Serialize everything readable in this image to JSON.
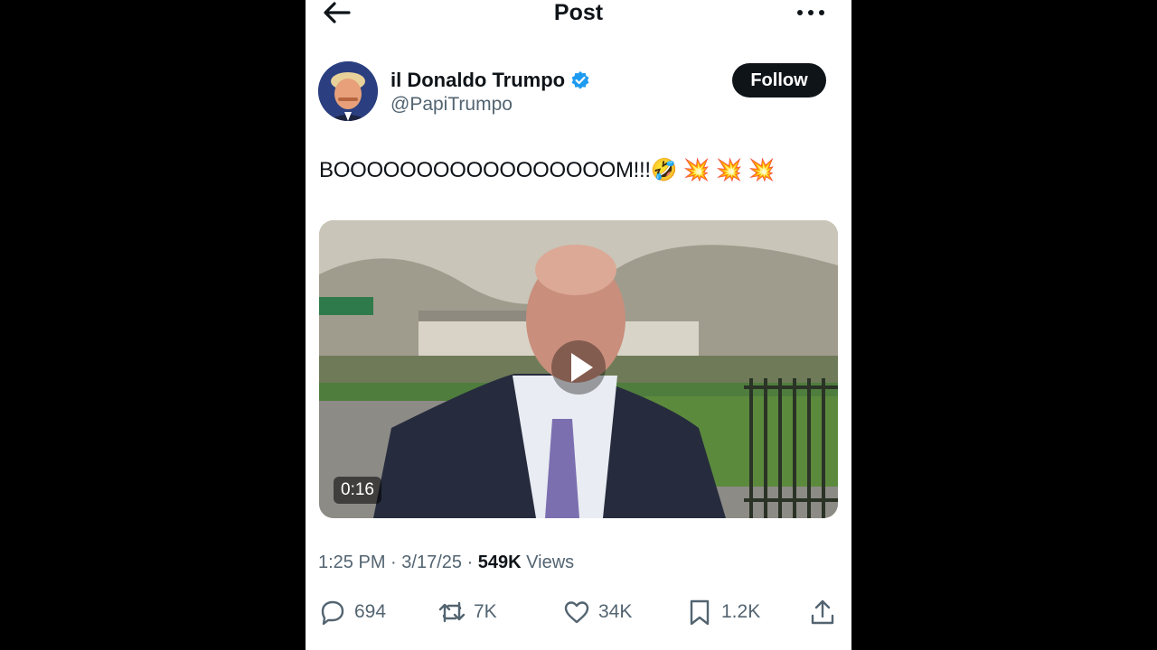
{
  "header": {
    "title": "Post",
    "back_icon": "arrow-left-icon",
    "more_icon": "more-horizontal-icon"
  },
  "author": {
    "display_name": "il Donaldo Trumpo",
    "handle": "@PapiTrumpo",
    "verified": true,
    "follow_label": "Follow"
  },
  "post": {
    "text": "BOOOOOOOOOOOOOOOOOM!!!🤣 💥 💥 💥",
    "video_duration": "0:16",
    "time": "1:25 PM",
    "date": "3/17/25",
    "views_count": "549K",
    "views_label": "Views"
  },
  "metrics": {
    "replies": "694",
    "reposts": "7K",
    "likes": "34K",
    "bookmarks": "1.2K"
  },
  "colors": {
    "text": "#0f1419",
    "secondary": "#536471",
    "verified": "#1d9bf0",
    "follow_bg": "#0f1419"
  }
}
